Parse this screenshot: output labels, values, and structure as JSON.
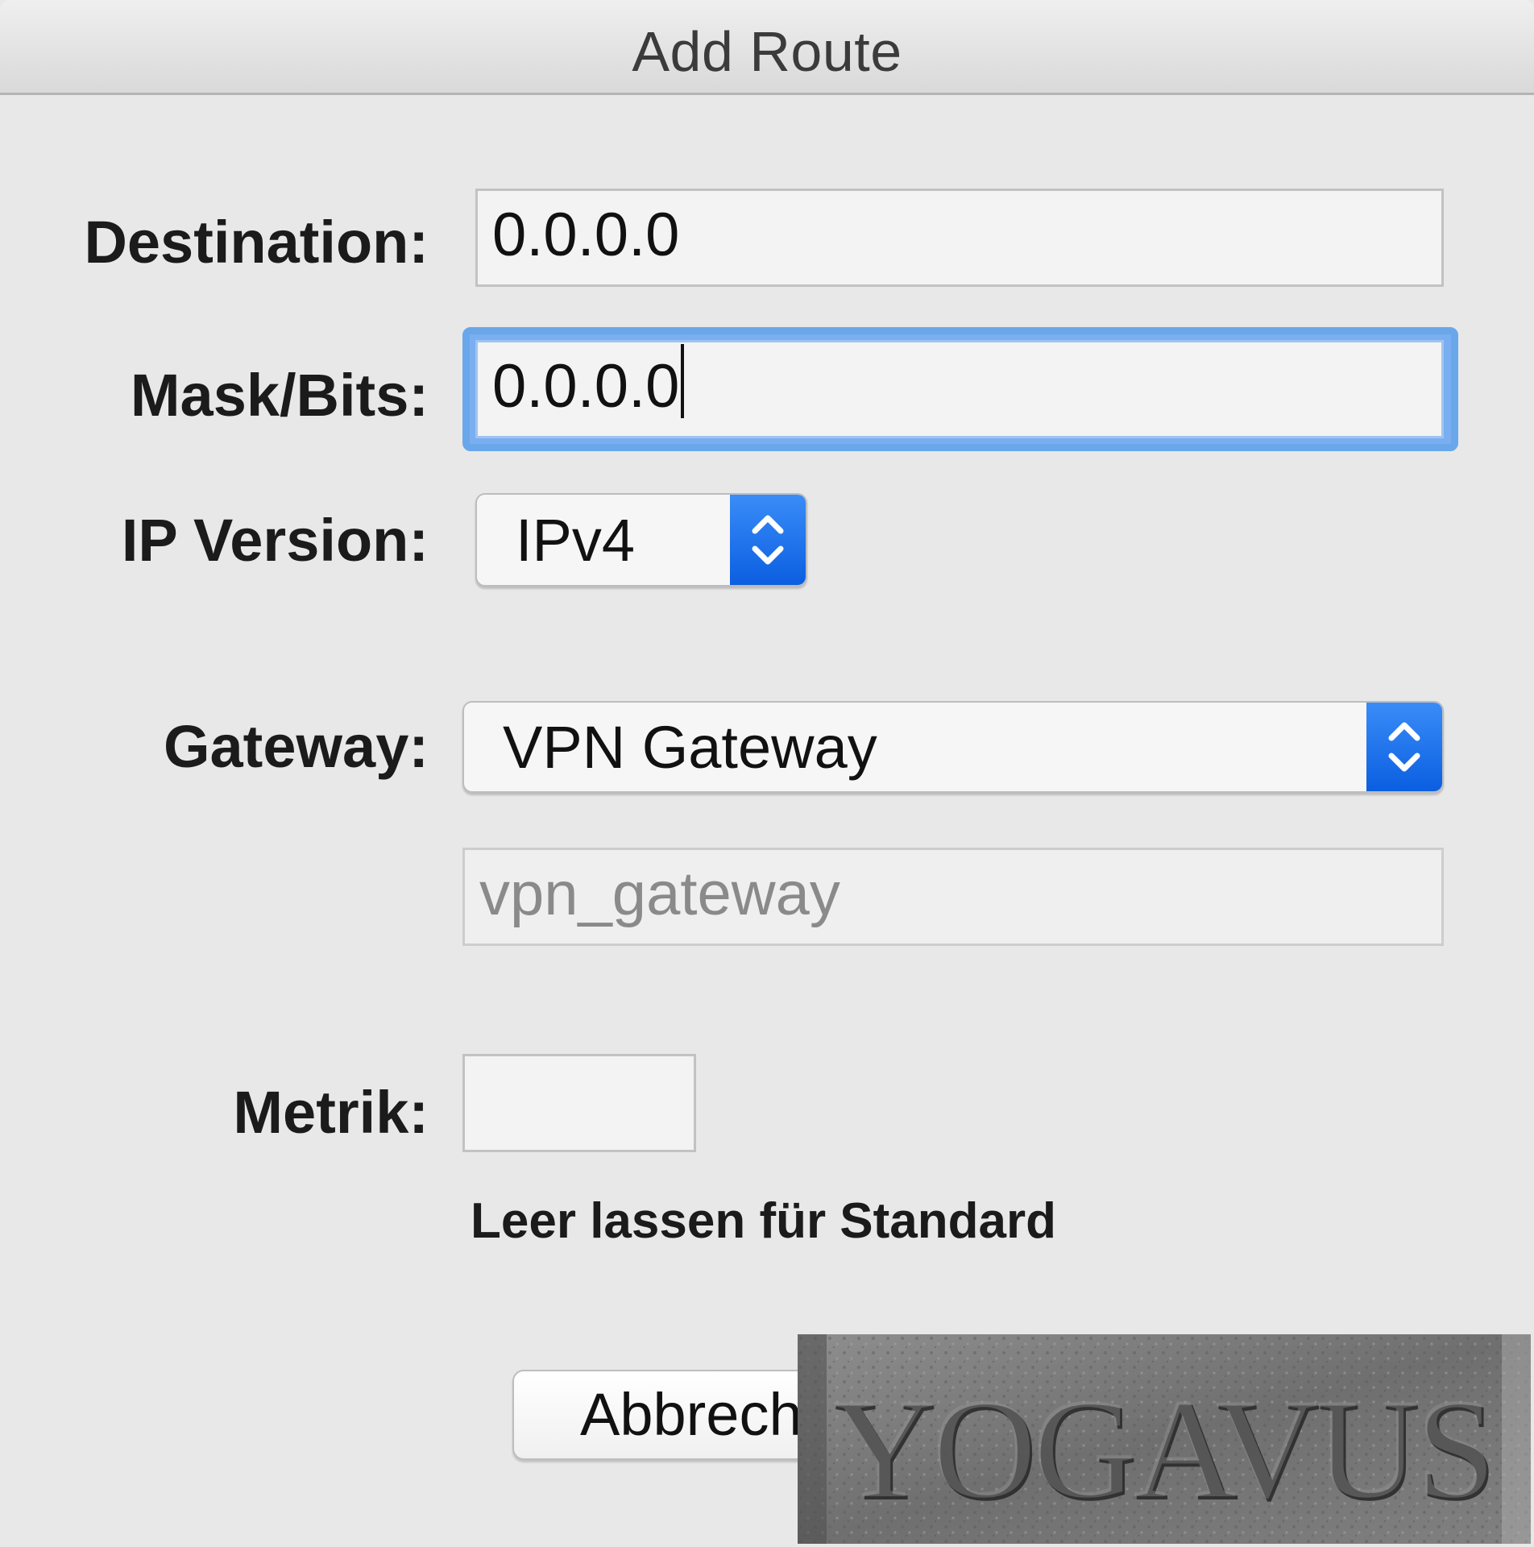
{
  "window": {
    "title": "Add Route"
  },
  "form": {
    "destination": {
      "label": "Destination:",
      "value": "0.0.0.0"
    },
    "mask": {
      "label": "Mask/Bits:",
      "value": "0.0.0.0"
    },
    "ip_version": {
      "label": "IP Version:",
      "selected": "IPv4"
    },
    "gateway": {
      "label": "Gateway:",
      "selected": "VPN Gateway",
      "field_placeholder": "vpn_gateway"
    },
    "metric": {
      "label": "Metrik:",
      "value": "",
      "hint": "Leer lassen für Standard"
    }
  },
  "buttons": {
    "cancel_label": "Abbrechen"
  },
  "watermark": {
    "text": "YOGAVUS"
  },
  "colors": {
    "focus": "#6aa7ea",
    "stepper": "#1a6ff0",
    "window_bg": "#e8e8e8"
  },
  "icons": {
    "stepper": "chevron-up-down-icon"
  }
}
